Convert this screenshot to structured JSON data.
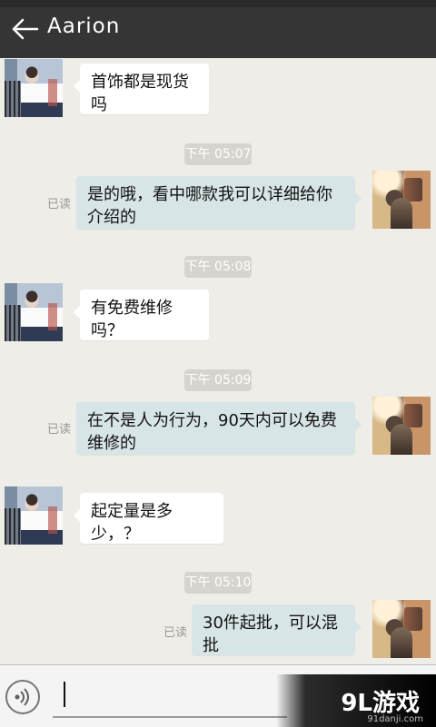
{
  "header": {
    "title": "Aarion",
    "back_icon": "back-arrow-icon"
  },
  "messages": [
    {
      "side": "left",
      "text": "首饰都是现货吗"
    },
    {
      "time": "下午 05:07"
    },
    {
      "side": "right",
      "read": "已读",
      "text": "是的哦，看中哪款我可以详细给你介绍的"
    },
    {
      "time": "下午 05:08"
    },
    {
      "side": "left",
      "text": "有免费维修吗？"
    },
    {
      "time": "下午 05:09"
    },
    {
      "side": "right",
      "read": "已读",
      "text": "在不是人为行为，90天内可以免费维修的"
    },
    {
      "side": "left",
      "text": "起定量是多少，？"
    },
    {
      "time": "下午 05:10"
    },
    {
      "side": "right",
      "read": "已读",
      "text": "30件起批，可以混批"
    }
  ],
  "input": {
    "voice_icon": "voice-icon",
    "value": ""
  },
  "watermark": {
    "main": "9L游戏",
    "sub": "91danji.com"
  }
}
